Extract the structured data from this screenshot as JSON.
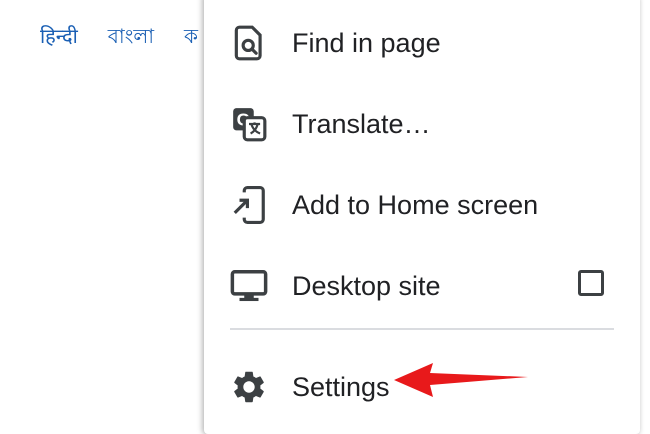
{
  "page": {
    "language_links": [
      "हिन्दी",
      "বাংলা",
      "ক"
    ]
  },
  "menu": {
    "items": [
      {
        "label": "Find in page",
        "icon": "find-in-page-icon"
      },
      {
        "label": "Translate…",
        "icon": "translate-icon"
      },
      {
        "label": "Add to Home screen",
        "icon": "add-to-home-screen-icon"
      },
      {
        "label": "Desktop site",
        "icon": "desktop-icon",
        "checkbox_checked": false
      },
      {
        "label": "Settings",
        "icon": "gear-icon"
      }
    ]
  },
  "annotation": {
    "arrow_color": "#e8191b",
    "points_to": "Settings"
  },
  "colors": {
    "link": "#1a5fb4",
    "text": "#202124",
    "icon": "#3c4043",
    "divider": "#dadce0"
  }
}
